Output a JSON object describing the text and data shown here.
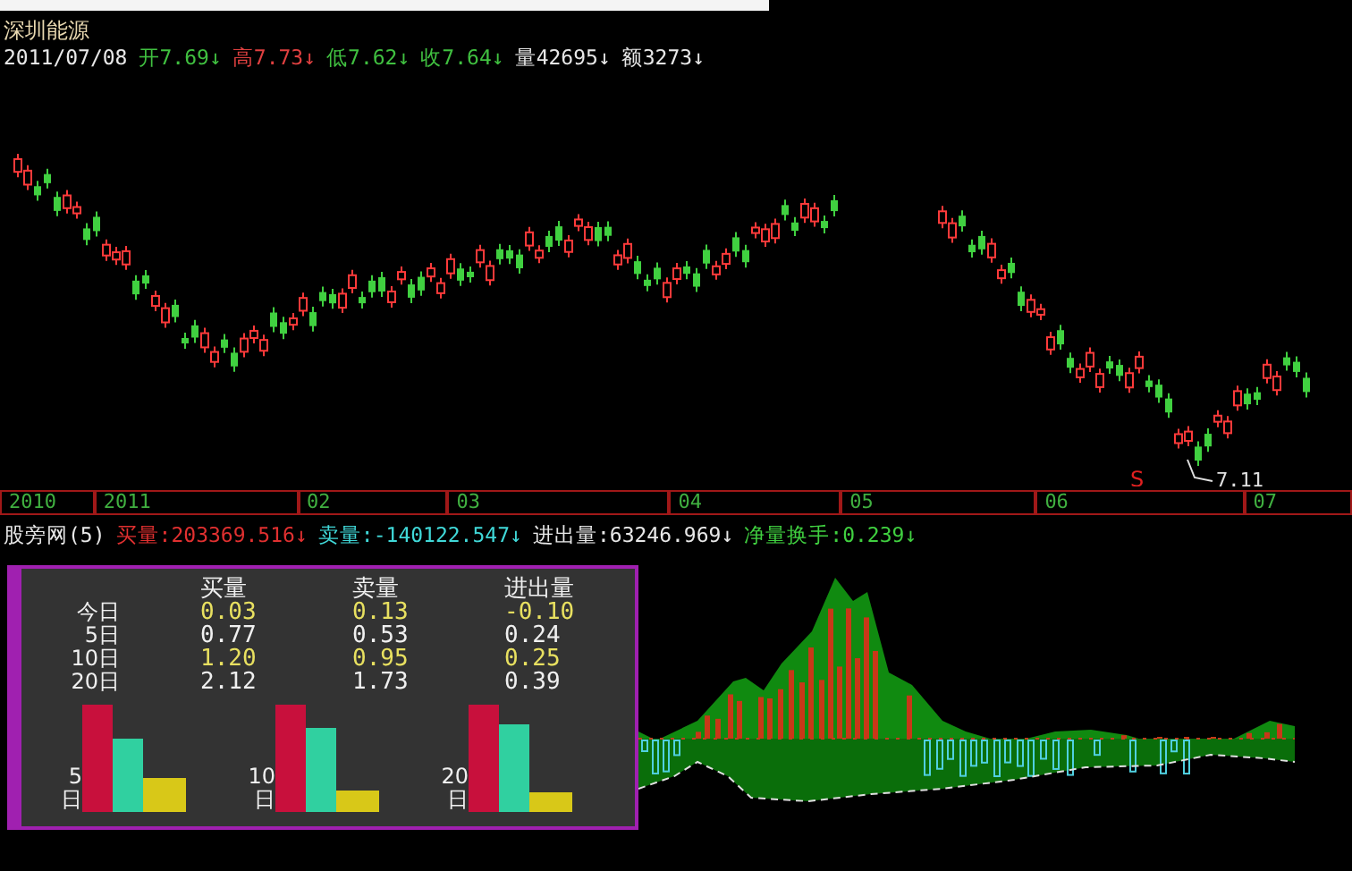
{
  "stock": {
    "name": "深圳能源",
    "date": "2011/07/08"
  },
  "quote": [
    {
      "label": "开",
      "value": "7.69",
      "arrow": "↓",
      "color": "#40c040"
    },
    {
      "label": "高",
      "value": "7.73",
      "arrow": "↓",
      "color": "#e04040"
    },
    {
      "label": "低",
      "value": "7.62",
      "arrow": "↓",
      "color": "#40c040"
    },
    {
      "label": "收",
      "value": "7.64",
      "arrow": "↓",
      "color": "#40c040"
    },
    {
      "label": "量",
      "value": "42695",
      "arrow": "↓",
      "color": "#e8e8e8"
    },
    {
      "label": "额",
      "value": "3273",
      "arrow": "↓",
      "color": "#e8e8e8"
    }
  ],
  "price_chart": {
    "signal": "S",
    "low_label": "7.11"
  },
  "time_axis": [
    "2010",
    "2011",
    "02",
    "03",
    "04",
    "05",
    "06",
    "07"
  ],
  "indicator": {
    "name": "股旁网(5)",
    "items": [
      {
        "label": "买量:",
        "value": "203369.516",
        "arrow": "↓",
        "color": "#e03030"
      },
      {
        "label": "卖量:",
        "value": "-140122.547",
        "arrow": "↓",
        "color": "#40d8d8"
      },
      {
        "label": "进出量:",
        "value": "63246.969",
        "arrow": "↓",
        "color": "#e8e8e8"
      },
      {
        "label": "净量换手:",
        "value": "0.239",
        "arrow": "↓",
        "color": "#40d040"
      }
    ]
  },
  "table": {
    "columns": [
      "买量",
      "卖量",
      "进出量"
    ],
    "rows": [
      {
        "label": "今日",
        "values": [
          "0.03",
          "0.13",
          "-0.10"
        ]
      },
      {
        "label": "5日",
        "values": [
          "0.77",
          "0.53",
          "0.24"
        ]
      },
      {
        "label": "10日",
        "values": [
          "1.20",
          "0.95",
          "0.25"
        ]
      },
      {
        "label": "20日",
        "values": [
          "2.12",
          "1.73",
          "0.39"
        ]
      }
    ]
  },
  "bar_groups": [
    {
      "label": [
        "5",
        "日"
      ]
    },
    {
      "label": [
        "10",
        "日"
      ]
    },
    {
      "label": [
        "20",
        "日"
      ]
    }
  ]
}
